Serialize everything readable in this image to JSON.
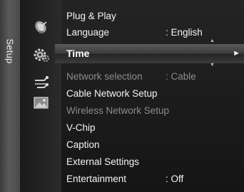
{
  "side_tab": {
    "label": "Setup"
  },
  "icons": [
    "satellite-icon",
    "gear-icon",
    "network-icon",
    "image-icon"
  ],
  "menu": {
    "items": [
      {
        "label": "Plug & Play",
        "value": "",
        "state": "normal"
      },
      {
        "label": "Language",
        "value": ": English",
        "state": "normal"
      },
      {
        "label": "Time",
        "value": "",
        "state": "selected",
        "arrow": "►"
      },
      {
        "label": "Network selection",
        "value": ": Cable",
        "state": "disabled"
      },
      {
        "label": "Cable Network Setup",
        "value": "",
        "state": "normal"
      },
      {
        "label": "Wireless Network Setup",
        "value": "",
        "state": "disabled"
      },
      {
        "label": "V-Chip",
        "value": "",
        "state": "normal"
      },
      {
        "label": "Caption",
        "value": "",
        "state": "normal"
      },
      {
        "label": "External Settings",
        "value": "",
        "state": "normal"
      },
      {
        "label": "Entertainment",
        "value": ": Off",
        "state": "normal"
      }
    ]
  },
  "scroll": {
    "up_glyph": "▲",
    "down_glyph": "▼"
  },
  "colors": {
    "text": "#f4f4f4",
    "disabled_text": "#8c8c8c",
    "highlight_top": "#5a5a5a",
    "highlight_bottom": "#242424"
  }
}
